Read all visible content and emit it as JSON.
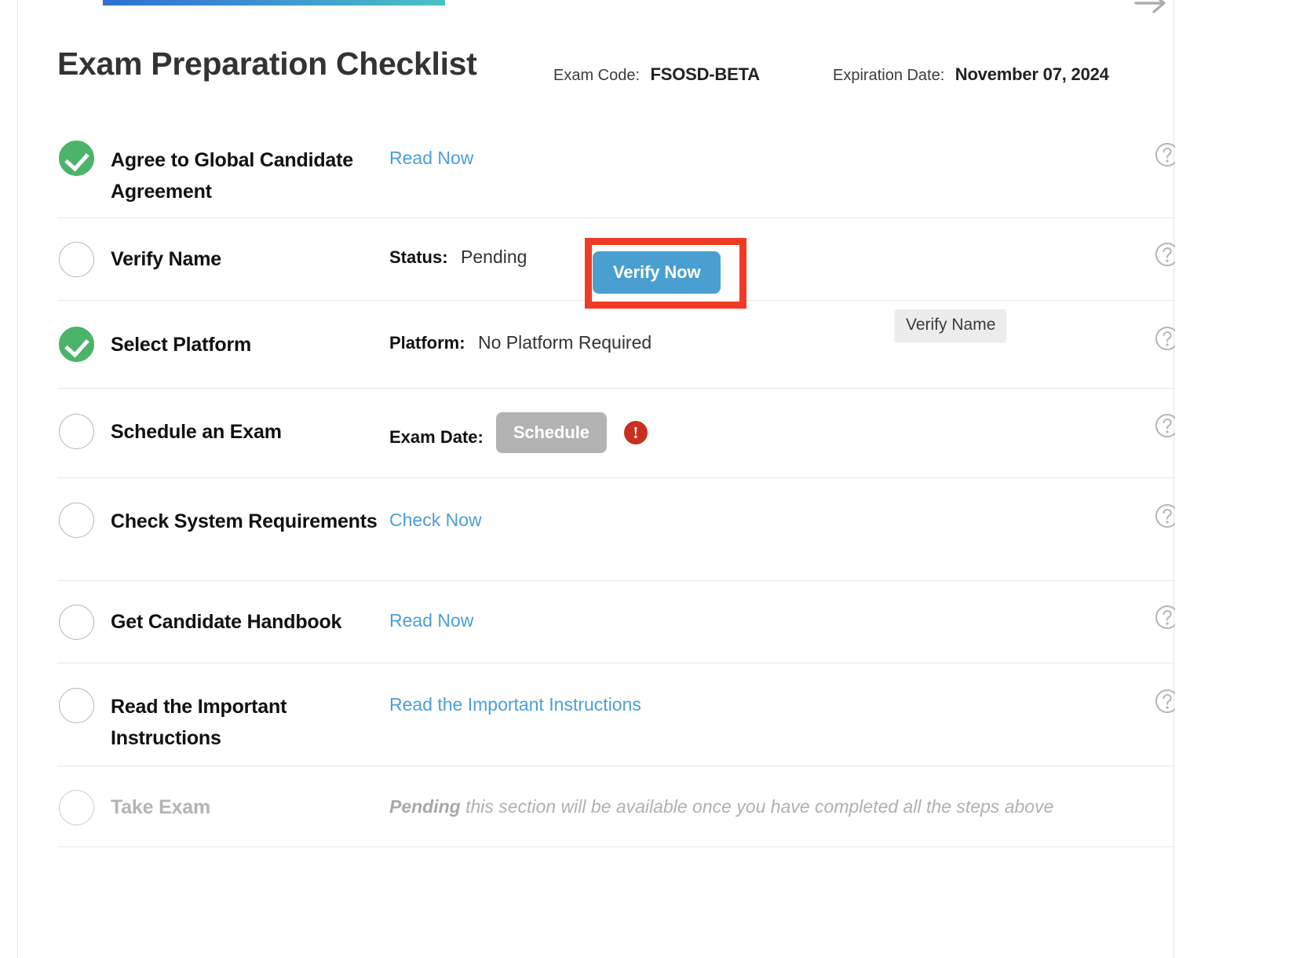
{
  "header": {
    "title": "Exam Preparation Checklist",
    "exam_code_label": "Exam Code:",
    "exam_code_value": "FSOSD-BETA",
    "expiration_label": "Expiration Date:",
    "expiration_value": "November 07, 2024"
  },
  "icons": {
    "help": "?",
    "warning": "!",
    "top_arrow": "arrow-right"
  },
  "tooltip": {
    "text": "Verify Name"
  },
  "highlight": {
    "color": "#ef3b24",
    "target": "Verify Now"
  },
  "colors": {
    "link": "#4a9fd8",
    "primary_button": "#4a9fd1",
    "disabled_button": "#b3b3b3",
    "complete": "#4cb36b",
    "warning": "#c9301f",
    "highlight": "#ef3b24",
    "muted_text": "#b0b0b0"
  },
  "rows": [
    {
      "id": "agree-global-candidate-agreement",
      "label": "Agree to Global Candidate Agreement",
      "state": "complete",
      "action_type": "link",
      "link_text": "Read Now"
    },
    {
      "id": "verify-name",
      "label": "Verify Name",
      "state": "incomplete",
      "action_type": "status-button",
      "field_label": "Status:",
      "field_value": "Pending",
      "button_text": "Verify Now"
    },
    {
      "id": "select-platform",
      "label": "Select Platform",
      "state": "complete",
      "action_type": "field",
      "field_label": "Platform:",
      "field_value": "No Platform Required"
    },
    {
      "id": "schedule-an-exam",
      "label": "Schedule an Exam",
      "state": "incomplete",
      "action_type": "schedule",
      "field_label": "Exam Date:",
      "button_text": "Schedule"
    },
    {
      "id": "check-system-requirements",
      "label": "Check System Requirements",
      "state": "incomplete",
      "action_type": "link",
      "link_text": "Check Now"
    },
    {
      "id": "get-candidate-handbook",
      "label": "Get Candidate Handbook",
      "state": "incomplete",
      "action_type": "link",
      "link_text": "Read Now"
    },
    {
      "id": "read-the-important-instructions",
      "label": "Read the Important Instructions",
      "state": "incomplete",
      "action_type": "link",
      "link_text": "Read the Important Instructions"
    },
    {
      "id": "take-exam",
      "label": "Take Exam",
      "state": "disabled",
      "action_type": "note",
      "note_bold": "Pending",
      "note_text": " this section will be available once you have completed all the steps above"
    }
  ]
}
